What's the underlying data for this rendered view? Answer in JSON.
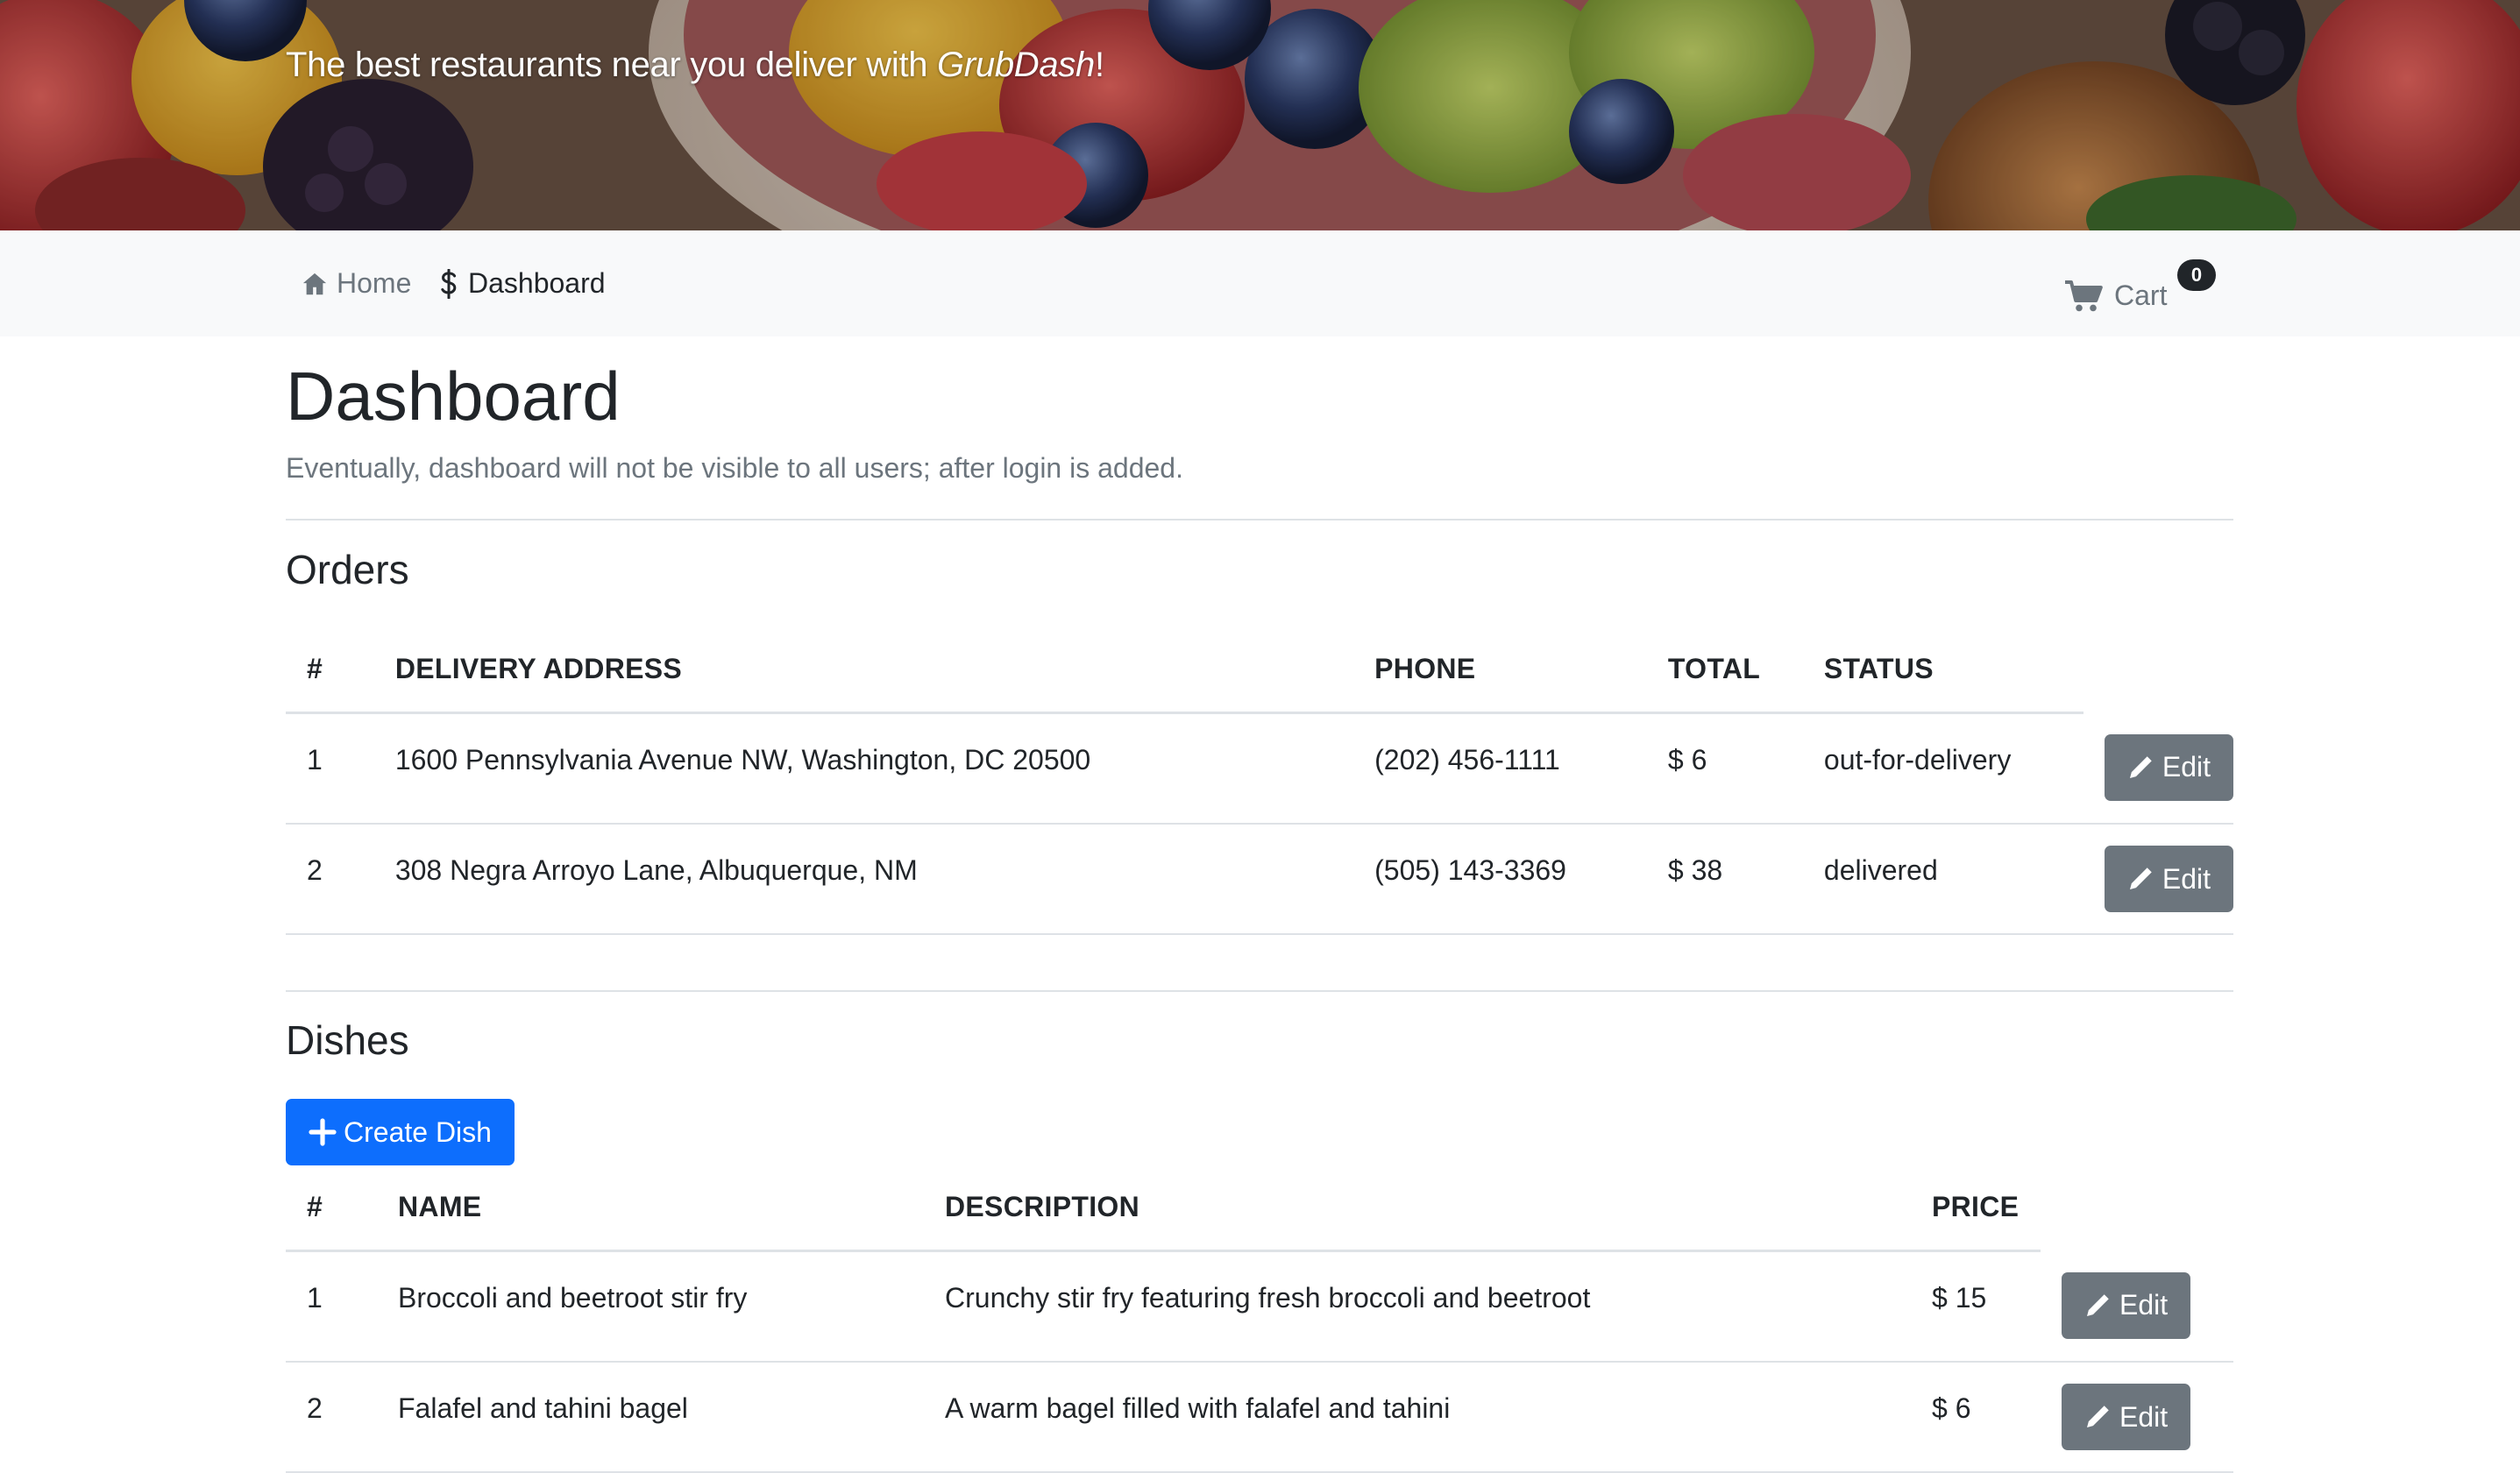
{
  "banner": {
    "tagline_prefix": "The best restaurants near you deliver with ",
    "tagline_brand": "GrubDash",
    "tagline_suffix": "!"
  },
  "nav": {
    "home_label": "Home",
    "dashboard_label": "Dashboard",
    "cart_label": "Cart",
    "cart_count": "0"
  },
  "page": {
    "title": "Dashboard",
    "lead": "Eventually, dashboard will not be visible to all users; after login is added."
  },
  "orders": {
    "title": "Orders",
    "columns": [
      "#",
      "Delivery Address",
      "Phone",
      "Total",
      "Status"
    ],
    "rows": [
      {
        "id": "1",
        "address": "1600 Pennsylvania Avenue NW, Washington, DC 20500",
        "phone": "(202) 456-1111",
        "total": "$ 6",
        "status": "out-for-delivery",
        "edit_label": "Edit"
      },
      {
        "id": "2",
        "address": "308 Negra Arroyo Lane, Albuquerque, NM",
        "phone": "(505) 143-3369",
        "total": "$ 38",
        "status": "delivered",
        "edit_label": "Edit"
      }
    ]
  },
  "dishes": {
    "title": "Dishes",
    "create_label": "Create Dish",
    "columns": [
      "#",
      "Name",
      "Description",
      "Price"
    ],
    "rows": [
      {
        "id": "1",
        "name": "Broccoli and beetroot stir fry",
        "description": "Crunchy stir fry featuring fresh broccoli and beetroot",
        "price": "$ 15",
        "edit_label": "Edit"
      },
      {
        "id": "2",
        "name": "Falafel and tahini bagel",
        "description": "A warm bagel filled with falafel and tahini",
        "price": "$ 6",
        "edit_label": "Edit"
      }
    ]
  },
  "colors": {
    "navbar_bg": "#f8f9fa",
    "primary": "#0d6efd",
    "secondary": "#6c757d",
    "text": "#212529",
    "muted": "#6c757d"
  },
  "icons": {
    "home": "house-icon",
    "dashboard": "dollar-icon",
    "cart": "cart-icon",
    "edit": "pencil-icon",
    "create": "plus-icon"
  }
}
